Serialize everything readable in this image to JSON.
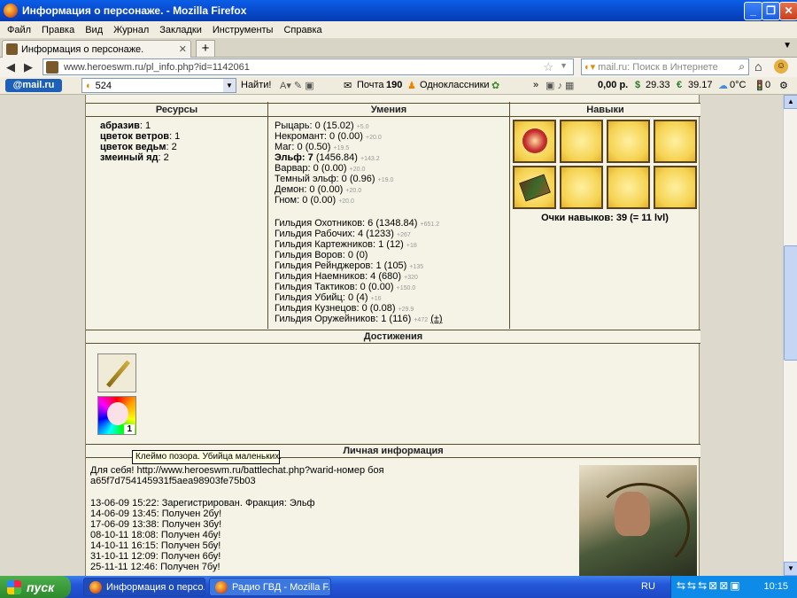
{
  "window": {
    "title": "Информация о персонаже. - Mozilla Firefox"
  },
  "menu": [
    "Файл",
    "Правка",
    "Вид",
    "Журнал",
    "Закладки",
    "Инструменты",
    "Справка"
  ],
  "tab": {
    "label": "Информация о персонаже."
  },
  "nav": {
    "url": "www.heroeswm.ru/pl_info.php?id=1142061",
    "search_placeholder": "mail.ru: Поиск в Интернете"
  },
  "mailbar": {
    "brand": "@mail.ru",
    "search_value": "524",
    "find_button": "Найти!",
    "mail_label": "Почта",
    "mail_count": "190",
    "ok_label": "Одноклассники",
    "balance": "0,00 р.",
    "usd": "29.33",
    "eur": "39.17",
    "weather": "0°C",
    "traffic": "0"
  },
  "sections": {
    "resources": "Ресурсы",
    "skills": "Умения",
    "talents": "Навыки",
    "achievements": "Достижения",
    "personal": "Личная информация"
  },
  "resources": [
    {
      "name": "абразив",
      "value": ": 1"
    },
    {
      "name": "цветок ветров",
      "value": ": 1"
    },
    {
      "name": "цветок ведьм",
      "value": ": 2"
    },
    {
      "name": "змеиный яд",
      "value": ": 2"
    }
  ],
  "skills": [
    {
      "name": "Рыцарь: 0 (15.02)",
      "extra": "+5.0",
      "bold": false
    },
    {
      "name": "Некромант: 0 (0.00)",
      "extra": "+20.0",
      "bold": false
    },
    {
      "name": "Маг: 0 (0.50)",
      "extra": "+19.5",
      "bold": false
    },
    {
      "name": "Эльф: 7",
      "rest": " (1456.84)",
      "extra": "+143.2",
      "bold": true
    },
    {
      "name": "Варвар: 0 (0.00)",
      "extra": "+20.0",
      "bold": false
    },
    {
      "name": "Темный эльф: 0 (0.96)",
      "extra": "+19.0",
      "bold": false
    },
    {
      "name": "Демон: 0 (0.00)",
      "extra": "+20.0",
      "bold": false
    },
    {
      "name": "Гном: 0 (0.00)",
      "extra": "+20.0",
      "bold": false
    }
  ],
  "guilds": [
    {
      "name": "Гильдия Охотников: 6 (1348.84)",
      "extra": "+651.2"
    },
    {
      "name": "Гильдия Рабочих: 4 (1233)",
      "extra": "+267"
    },
    {
      "name": "Гильдия Картежников: 1 (12)",
      "extra": "+18"
    },
    {
      "name": "Гильдия Воров: 0 (0)",
      "extra": ""
    },
    {
      "name": "Гильдия Рейнджеров: 1 (105)",
      "extra": "+135"
    },
    {
      "name": "Гильдия Наемников: 4 (680)",
      "extra": "+320"
    },
    {
      "name": "Гильдия Тактиков: 0 (0.00)",
      "extra": "+150.0"
    },
    {
      "name": "Гильдия Убийц: 0 (4)",
      "extra": "+16"
    },
    {
      "name": "Гильдия Кузнецов: 0 (0.08)",
      "extra": "+29.9"
    },
    {
      "name": "Гильдия Оружейников: 1 (116)",
      "extra": "+472",
      "plus": "(±)"
    }
  ],
  "talent_points": "Очки навыков: 39 (= 11 lvl)",
  "achievement_badge": "1",
  "tooltip": "Клеймо позора. Убийца маленьких.",
  "personal": {
    "line1": "Для себя! http://www.heroeswm.ru/battlechat.php?warid-номер боя",
    "line2": "a65f7d754145931f5aea98903fe75b03",
    "log": [
      "13-06-09 15:22: Зарегистрирован. Фракция: Эльф",
      "14-06-09 13:45: Получен 2бу!",
      "17-06-09 13:38: Получен 3бу!",
      "08-10-11 18:08: Получен 4бу!",
      "14-10-11 16:15: Получен 5бу!",
      "31-10-11 12:09: Получен 6бу!",
      "25-11-11 12:46: Получен 7бу!"
    ]
  },
  "taskbar": {
    "start": "пуск",
    "items": [
      "Информация о персо...",
      "Радио ГВД - Mozilla F..."
    ],
    "lang": "RU",
    "clock": "10:15"
  }
}
